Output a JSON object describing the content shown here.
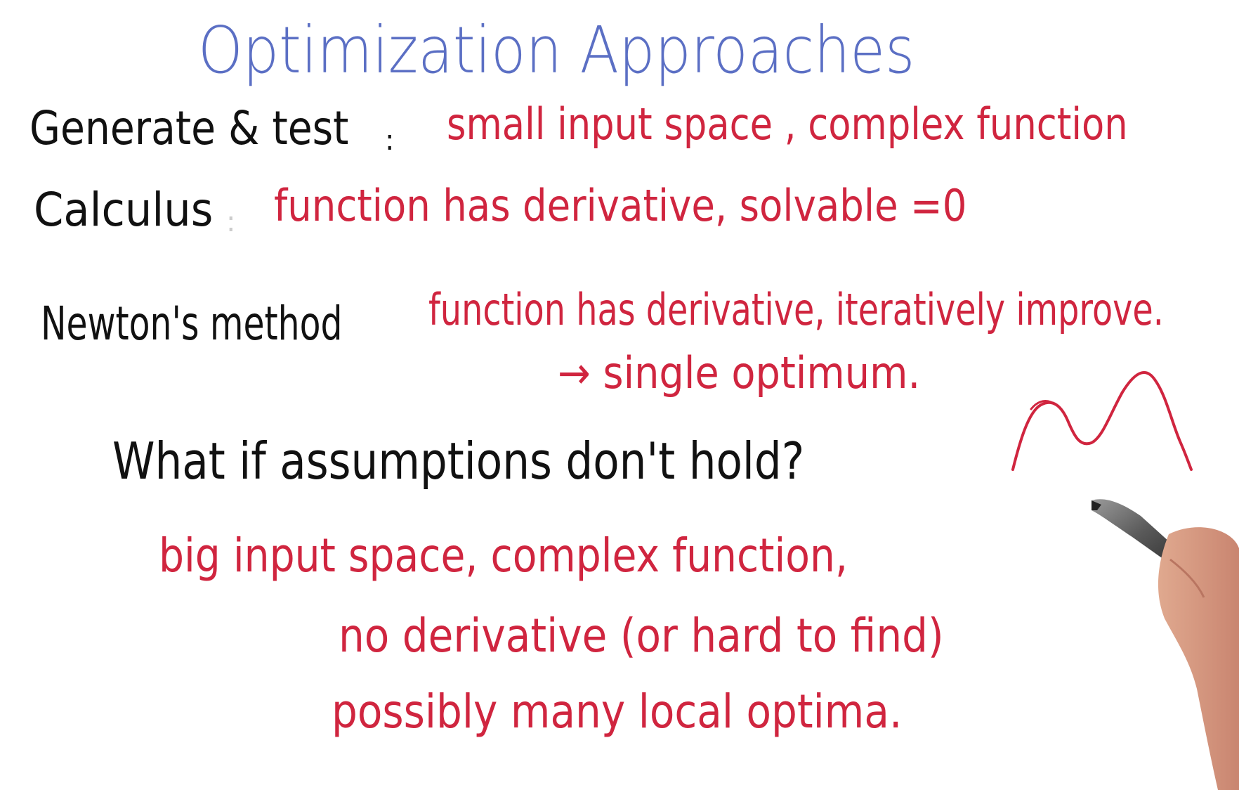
{
  "title": "Optimization Approaches",
  "colors": {
    "title": "#5b6fc4",
    "label": "#111111",
    "accent": "#d0253f"
  },
  "approaches": [
    {
      "name": "Generate & test",
      "separator": ":",
      "description": "small input space , complex function"
    },
    {
      "name": "Calculus",
      "separator": ":",
      "description": "function has derivative, solvable =0"
    },
    {
      "name": "Newton's method",
      "description": "function has derivative, iteratively improve."
    }
  ],
  "newton_note": "→ single optimum.",
  "question": "What if assumptions don't hold?",
  "conditions": [
    "big input space, complex function,",
    "no derivative (or hard to find)",
    "possibly many local optima."
  ],
  "icons": {
    "sketch": "two-peak-curve-icon",
    "hand": "hand-with-marker-icon"
  }
}
